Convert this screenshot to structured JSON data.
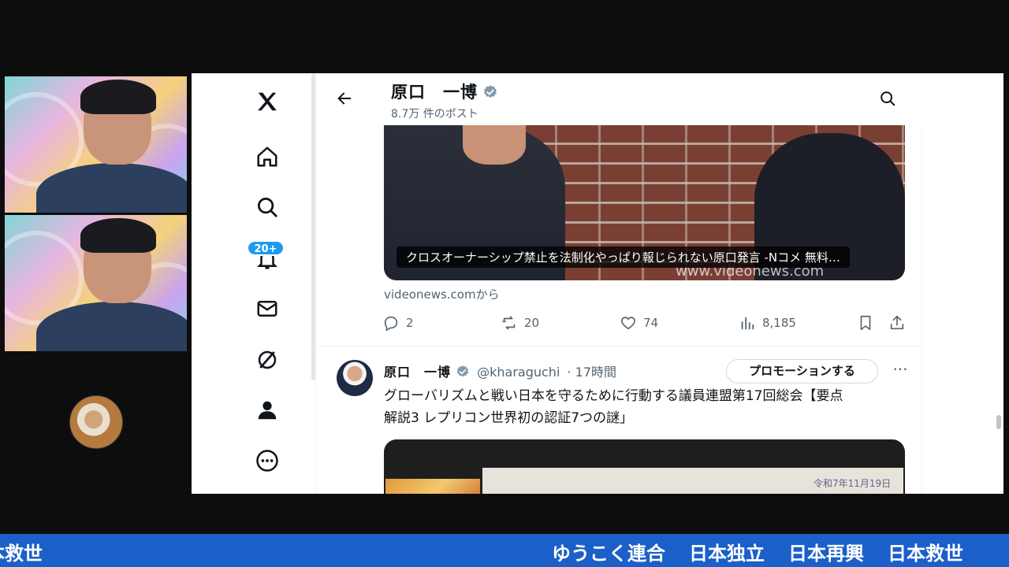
{
  "profile_header": {
    "name": "原口　一博",
    "post_count": "8.7万 件のポスト"
  },
  "nav": {
    "notification_badge": "20+",
    "items": [
      "x-logo",
      "home",
      "explore",
      "notifications",
      "messages",
      "grok",
      "profile",
      "more"
    ]
  },
  "tweet1": {
    "video_caption": "クロスオーナーシップ禁止を法制化やっぱり報じられない原口発言 -Nコメ 無料…",
    "link_domain": "videonews.comから",
    "replies": "2",
    "reposts": "20",
    "likes": "74",
    "views": "8,185"
  },
  "tweet2": {
    "name": "原口　一博",
    "handle": "@kharaguchi",
    "time": "· 17時間",
    "promote_label": "プロモーションする",
    "more_label": "···",
    "text_line1": "グローバリズムと戦い日本を守るために行動する議員連盟第17回総会【要点",
    "text_line2": "解説3 レプリコン世界初の認証7つの謎」"
  },
  "ticker": {
    "left_fragment": "本救世",
    "items": [
      "ゆうこく連合",
      "日本独立",
      "日本再興",
      "日本救世"
    ]
  },
  "colors": {
    "accent": "#1d9bf0",
    "ticker_bg": "#1b5fc9",
    "text_primary": "#0f1419",
    "text_secondary": "#536471"
  }
}
